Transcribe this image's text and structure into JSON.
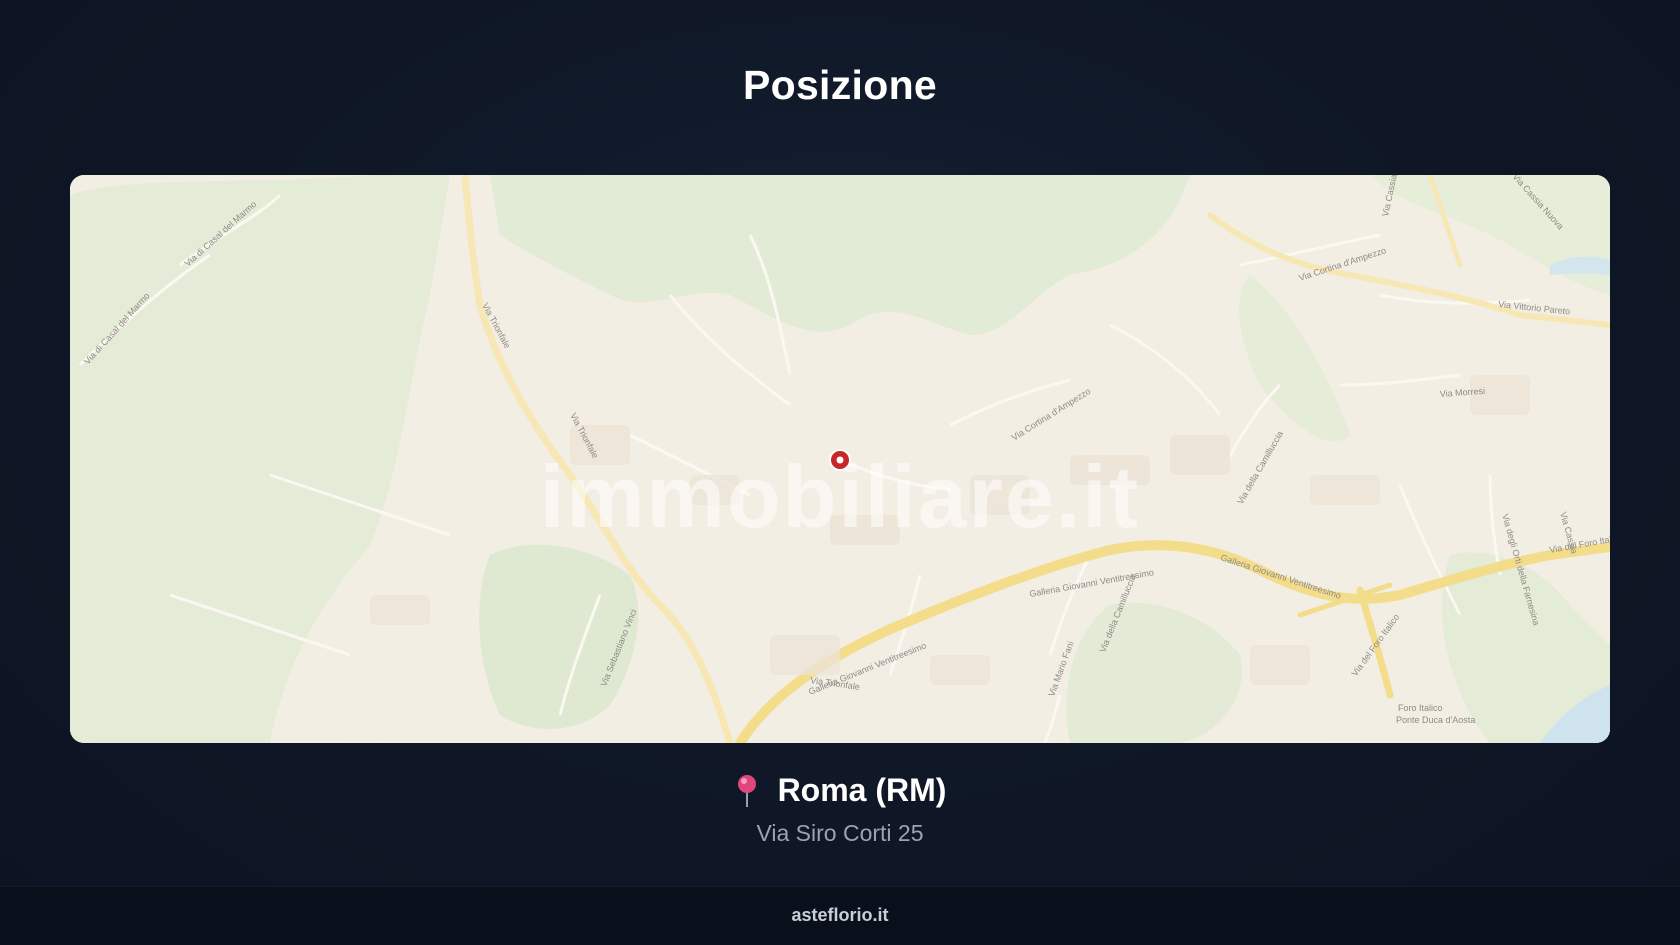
{
  "section": {
    "title": "Posizione"
  },
  "map": {
    "watermark": "immobiliare.it",
    "street_labels": [
      "Via di Casal del Marmo",
      "Via di Casal del Marmo",
      "Via Trionfale",
      "Via Trionfale",
      "Via Cortina d'Ampezzo",
      "Via Cortina d'Ampezzo",
      "Via della Camilluccia",
      "Via della Camilluccia",
      "Galleria Giovanni Ventitreesimo",
      "Galleria Giovanni Ventitreesimo",
      "Galleria Giovanni Ventitreesimo",
      "Via del Foro Italico",
      "Via del Foro Italico",
      "Via Sebastiano Vinci",
      "Via Mario Fani",
      "Via Trionfale",
      "Via Cassia Nuova",
      "Via Cassia",
      "Via Vittorio Pareto",
      "Via Morresi",
      "Via degli Orti della Farnesina",
      "Via Cassia",
      "Foro Italico",
      "Ponte Duca d'Aosta"
    ],
    "marker_icon": "map-marker-icon"
  },
  "location": {
    "pin_icon": "round-pushpin-icon",
    "city": "Roma (RM)",
    "address": "Via Siro Corti 25"
  },
  "footer": {
    "text": "asteflorio.it"
  },
  "colors": {
    "background": "#0f1726",
    "title": "#ffffff",
    "address": "#9aa3b2",
    "marker": "#c62828",
    "pin": "#e0457b"
  }
}
